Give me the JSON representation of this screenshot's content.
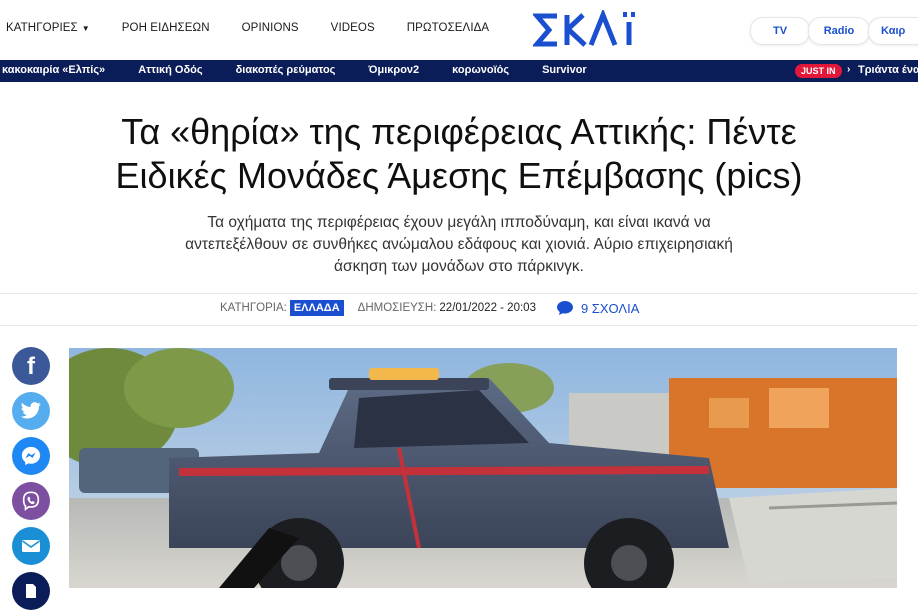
{
  "header": {
    "nav": [
      {
        "label": "ΚΑΤΗΓΟΡΙΕΣ",
        "has_dropdown": true
      },
      {
        "label": "ΡΟΗ ΕΙΔΗΣΕΩΝ"
      },
      {
        "label": "OPINIONS"
      },
      {
        "label": "VIDEOS"
      },
      {
        "label": "ΠΡΩΤΟΣΕΛΙΔΑ"
      }
    ],
    "logo_text": "ΣΚΑΪ",
    "right_links": [
      "TV",
      "Radio",
      "Καιρ"
    ],
    "accent_color": "#1a4fd0"
  },
  "trending": {
    "items": [
      "κακοκαιρία «Ελπίς»",
      "Αττική Οδός",
      "διακοπές ρεύματος",
      "Όμικρον2",
      "κορωνοϊός",
      "Survivor"
    ],
    "just_in_label": "JUST IN",
    "just_in_arrow": "›",
    "just_in_text": "Τριάντα ένα",
    "bar_color": "#0b1d58"
  },
  "article": {
    "title_line1": "Τα «θηρία» της περιφέρειας Αττικής: Πέντε",
    "title_line2": "Ειδικές Μονάδες Άμεσης Επέμβασης (pics)",
    "subtitle_line1": "Τα οχήματα της περιφέρειας έχουν μεγάλη ιπποδύναμη, και είναι ικανά να",
    "subtitle_line2": "αντεπεξέλθουν σε συνθήκες ανώμαλου εδάφους και χιονιά. Αύριο επιχειρησιακή",
    "subtitle_line3": "άσκηση των μονάδων στο πάρκινγκ.",
    "meta": {
      "category_label": "ΚΑΤΗΓΟΡΙΑ:",
      "category": "ΕΛΛΑΔΑ",
      "published_label": "ΔΗΜΟΣΙΕΥΣΗ:",
      "published": "22/01/2022 - 20:03",
      "comments": "9 ΣΧΟΛΙΑ"
    }
  },
  "social": [
    {
      "icon": "facebook-icon",
      "color": "#3b5998",
      "glyph": "f"
    },
    {
      "icon": "twitter-icon",
      "color": "#55acee"
    },
    {
      "icon": "messenger-icon",
      "color": "#1e88f5"
    },
    {
      "icon": "viber-icon",
      "color": "#7d4fa0"
    },
    {
      "icon": "email-icon",
      "color": "#1a8fd6"
    },
    {
      "icon": "print-icon",
      "color": "#0b1d58"
    }
  ]
}
